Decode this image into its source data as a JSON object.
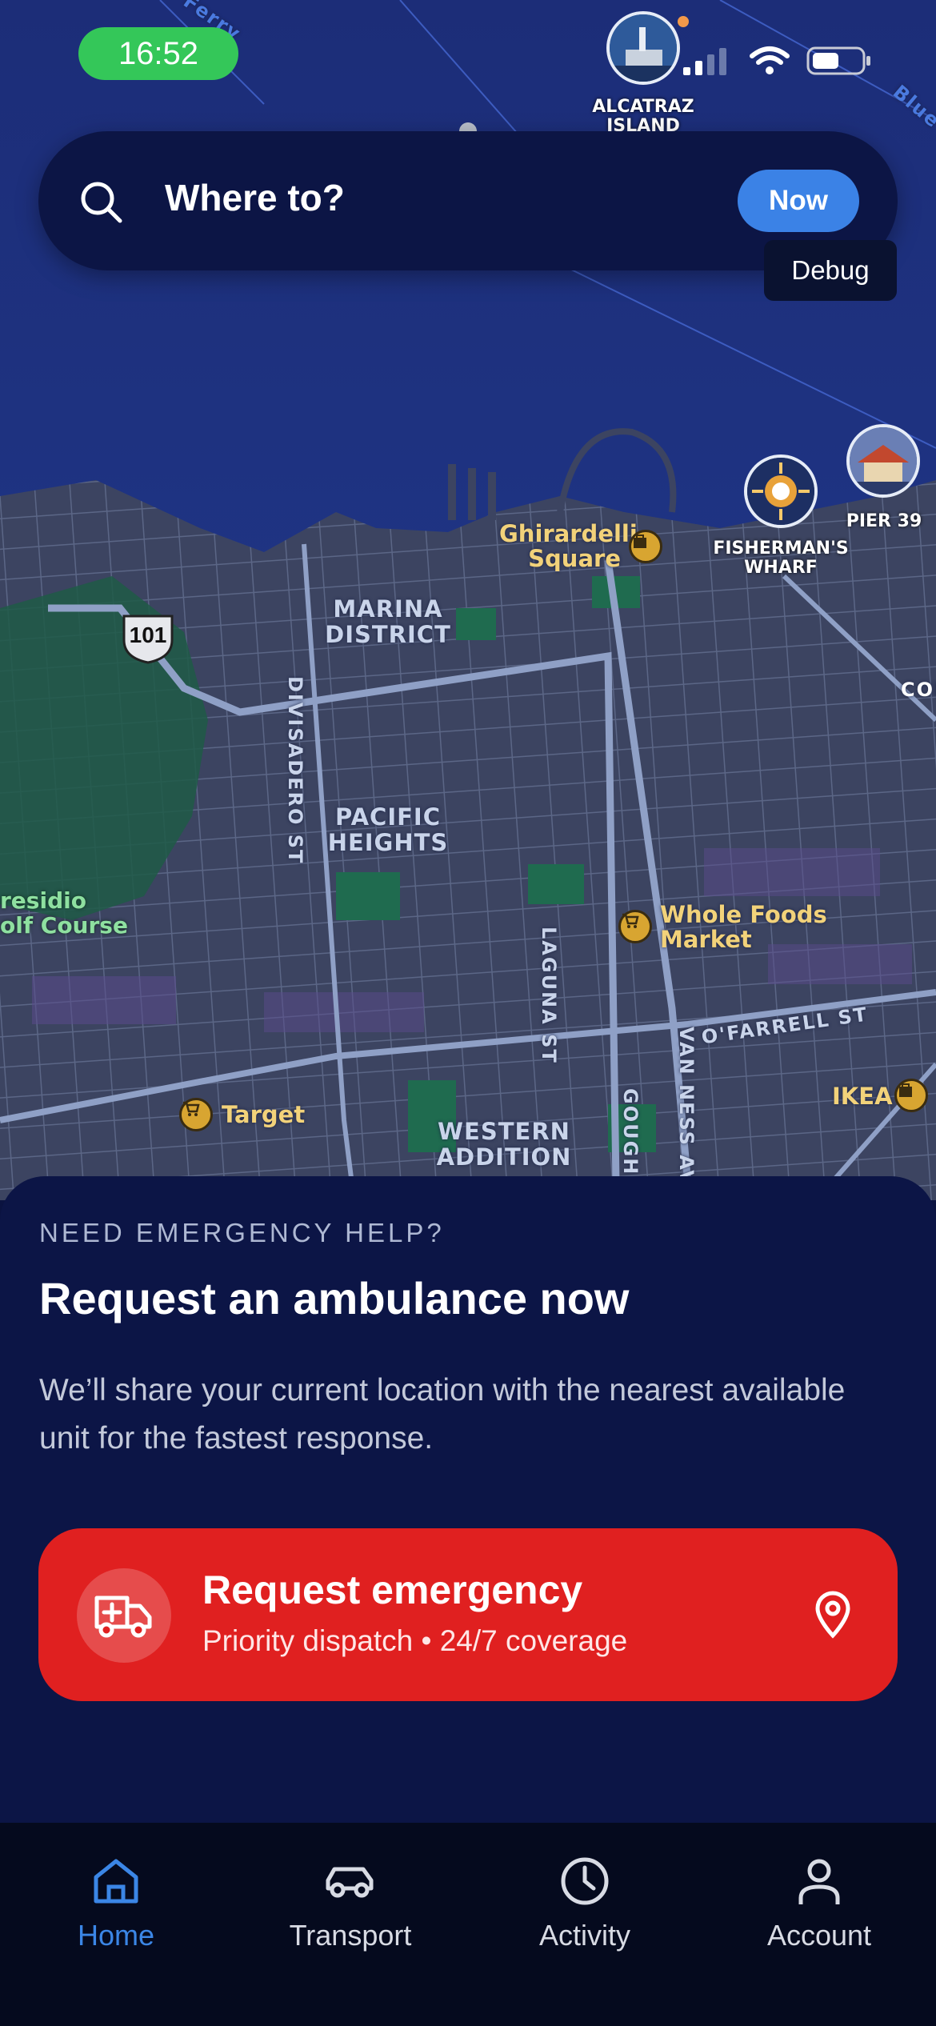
{
  "status_bar": {
    "time": "16:52"
  },
  "search": {
    "placeholder_text": "Where to?",
    "now_label": "Now"
  },
  "debug_label": "Debug",
  "map": {
    "landmarks": [
      {
        "name": "ALCATRAZ ISLAND",
        "line1": "ALCATRAZ",
        "line2": "ISLAND"
      },
      {
        "name": "FISHERMAN'S WHARF",
        "line1": "FISHERMAN'S",
        "line2": "WHARF"
      },
      {
        "name": "PIER 39",
        "line1": "PIER 39",
        "line2": ""
      }
    ],
    "districts": [
      {
        "line1": "MARINA",
        "line2": "DISTRICT"
      },
      {
        "line1": "PACIFIC",
        "line2": "HEIGHTS"
      },
      {
        "line1": "WESTERN",
        "line2": "ADDITION"
      }
    ],
    "streets": [
      "DIVISADERO ST",
      "LAGUNA ST",
      "VAN NESS AV",
      "GOUGH",
      "O'FARRELL ST"
    ],
    "highway_shield": "101",
    "pois": [
      {
        "line1": "Ghirardelli",
        "line2": "Square"
      },
      {
        "line1": "Whole Foods",
        "line2": "Market"
      },
      {
        "line1": "Target",
        "line2": ""
      },
      {
        "line1": "IKEA",
        "line2": ""
      }
    ],
    "park": {
      "line1": "residio",
      "line2": "olf Course"
    },
    "edge_labels": {
      "ferry": "Ferry",
      "blue": "Blue & ",
      "col": "COL"
    }
  },
  "emergency": {
    "eyebrow": "NEED EMERGENCY HELP?",
    "headline": "Request an ambulance now",
    "description": "We’ll share your current location with the nearest available unit for the fastest response.",
    "button_title": "Request emergency",
    "button_subtitle": "Priority dispatch • 24/7 coverage"
  },
  "tabs": [
    {
      "label": "Home",
      "icon": "home-icon",
      "active": true
    },
    {
      "label": "Transport",
      "icon": "car-icon",
      "active": false
    },
    {
      "label": "Activity",
      "icon": "clock-icon",
      "active": false
    },
    {
      "label": "Account",
      "icon": "person-icon",
      "active": false
    }
  ],
  "colors": {
    "accent": "#3b86e6",
    "emergency": "#e02020",
    "sheet": "#0c1546",
    "water": "#1d3482",
    "time_pill": "#34c759"
  }
}
